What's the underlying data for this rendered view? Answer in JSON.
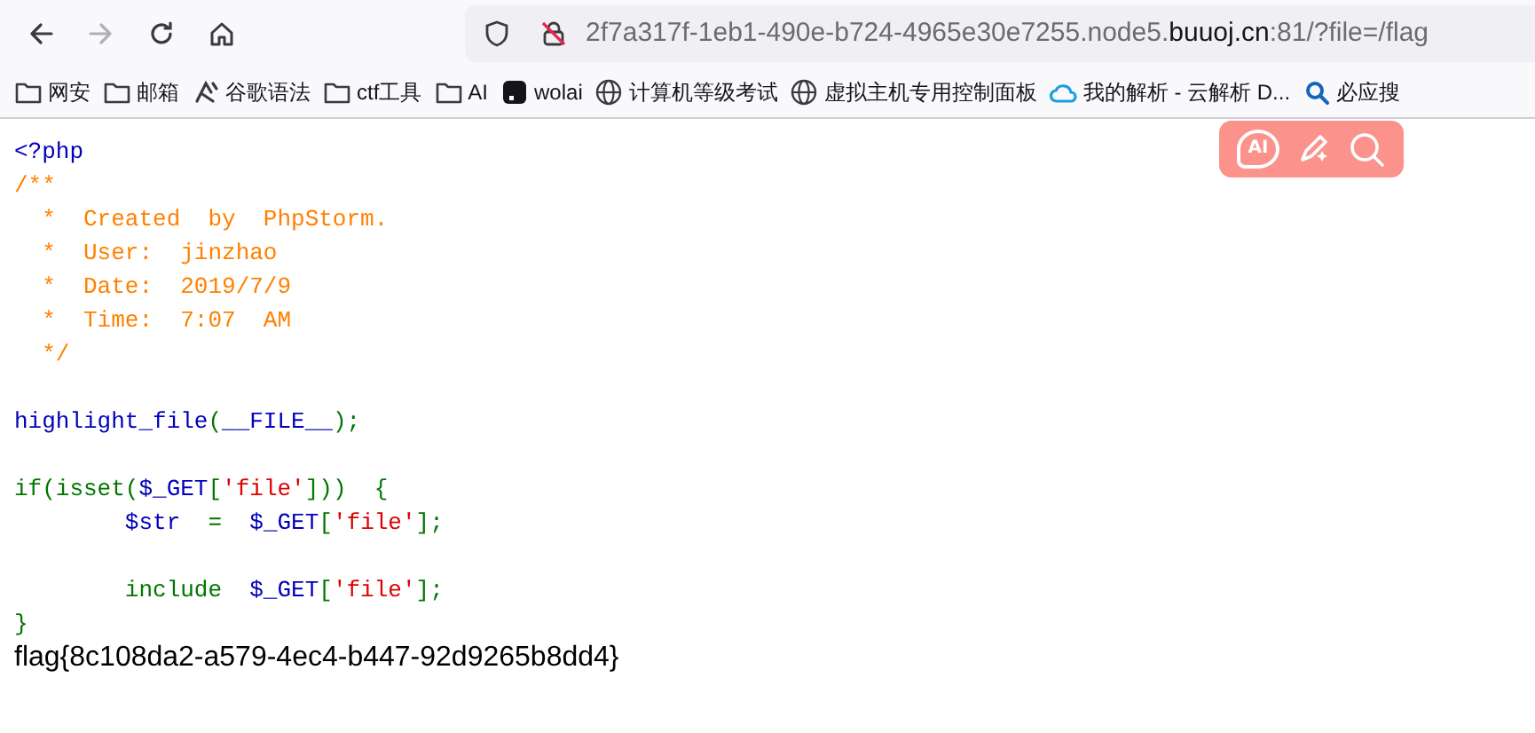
{
  "nav": [
    {
      "kind": "back",
      "disabled": false
    },
    {
      "kind": "forward",
      "disabled": true
    },
    {
      "kind": "reload",
      "disabled": false
    },
    {
      "kind": "home",
      "disabled": false
    }
  ],
  "address": {
    "prefix": "2f7a317f-1eb1-490e-b724-4965e30e7255.node5.",
    "domain": "buuoj.cn",
    "suffix": ":81/?file=/flag"
  },
  "bookmarks": [
    {
      "kind": "folder",
      "label": "网安"
    },
    {
      "kind": "folder",
      "label": "邮箱"
    },
    {
      "kind": "custom",
      "label": "谷歌语法"
    },
    {
      "kind": "folder",
      "label": "ctf工具"
    },
    {
      "kind": "folder",
      "label": "AI"
    },
    {
      "kind": "app",
      "label": "wolai"
    },
    {
      "kind": "globe",
      "label": "计算机等级考试"
    },
    {
      "kind": "globe",
      "label": "虚拟主机专用控制面板"
    },
    {
      "kind": "cloud",
      "label": "我的解析 - 云解析 D..."
    },
    {
      "kind": "search",
      "label": "必应搜"
    }
  ],
  "floating_toolbar": [
    {
      "kind": "ai",
      "label": "AI"
    },
    {
      "kind": "pen"
    },
    {
      "kind": "search"
    }
  ],
  "code_lines": [
    {
      "blank_line_before": false,
      "tokens": [
        {
          "text": "<?php",
          "kind": "default"
        }
      ]
    },
    {
      "blank_line_before": false,
      "tokens": [
        {
          "text": "/**",
          "kind": "comment"
        }
      ]
    },
    {
      "blank_line_before": false,
      "tokens": [
        {
          "text": "  *  Created  by  PhpStorm.",
          "kind": "comment"
        }
      ]
    },
    {
      "blank_line_before": false,
      "tokens": [
        {
          "text": "  *  User:  jinzhao",
          "kind": "comment"
        }
      ]
    },
    {
      "blank_line_before": false,
      "tokens": [
        {
          "text": "  *  Date:  2019/7/9",
          "kind": "comment"
        }
      ]
    },
    {
      "blank_line_before": false,
      "tokens": [
        {
          "text": "  *  Time:  7:07  AM",
          "kind": "comment"
        }
      ]
    },
    {
      "blank_line_before": false,
      "tokens": [
        {
          "text": "  */",
          "kind": "comment"
        }
      ]
    },
    {
      "blank_line_before": true,
      "tokens": [
        {
          "text": "highlight_file",
          "kind": "default"
        },
        {
          "text": "(",
          "kind": "keyword"
        },
        {
          "text": "__FILE__",
          "kind": "default"
        },
        {
          "text": ");",
          "kind": "keyword"
        }
      ]
    },
    {
      "blank_line_before": true,
      "tokens": [
        {
          "text": "if(isset(",
          "kind": "keyword"
        },
        {
          "text": "$_GET",
          "kind": "default"
        },
        {
          "text": "[",
          "kind": "keyword"
        },
        {
          "text": "'file'",
          "kind": "string"
        },
        {
          "text": "]))  {",
          "kind": "keyword"
        }
      ]
    },
    {
      "blank_line_before": false,
      "tokens": [
        {
          "text": "        $str",
          "kind": "default"
        },
        {
          "text": "  =  ",
          "kind": "keyword"
        },
        {
          "text": "$_GET",
          "kind": "default"
        },
        {
          "text": "[",
          "kind": "keyword"
        },
        {
          "text": "'file'",
          "kind": "string"
        },
        {
          "text": "];",
          "kind": "keyword"
        }
      ]
    },
    {
      "blank_line_before": true,
      "tokens": [
        {
          "text": "        include  ",
          "kind": "keyword"
        },
        {
          "text": "$_GET",
          "kind": "default"
        },
        {
          "text": "[",
          "kind": "keyword"
        },
        {
          "text": "'file'",
          "kind": "string"
        },
        {
          "text": "];",
          "kind": "keyword"
        }
      ]
    },
    {
      "blank_line_before": false,
      "tokens": [
        {
          "text": "}",
          "kind": "keyword"
        }
      ]
    }
  ],
  "output": "flag{8c108da2-a579-4ec4-b447-92d9265b8dd4}"
}
